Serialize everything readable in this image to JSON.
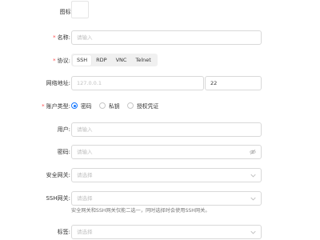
{
  "form": {
    "icon": {
      "label": "图标"
    },
    "name": {
      "label": "名称",
      "placeholder": "请输入"
    },
    "protocol": {
      "label": "协议",
      "options": [
        "SSH",
        "RDP",
        "VNC",
        "Telnet"
      ],
      "selected": "SSH"
    },
    "address": {
      "label": "网络地址",
      "host_placeholder": "127.0.0.1",
      "port_value": "22"
    },
    "account_type": {
      "label": "账户类型",
      "options": [
        "密码",
        "私钥",
        "授权凭证"
      ],
      "selected": "密码"
    },
    "user": {
      "label": "用户",
      "placeholder": "请输入"
    },
    "password": {
      "label": "密码",
      "placeholder": "请输入"
    },
    "gateway": {
      "label": "安全网关",
      "placeholder": "请选择"
    },
    "ssh_gateway": {
      "label": "SSH网关",
      "placeholder": "请选择",
      "helper": "安全网关和SSH网关仅能二选一，同时选择时会使用SSH网关。"
    },
    "tags": {
      "label": "标签",
      "placeholder": "请选择"
    }
  },
  "colors": {
    "primary": "#1677ff",
    "required": "#ff4d4f",
    "border": "#d9d9d9",
    "placeholder": "#bfbfbf"
  },
  "icons": {
    "password_toggle": "eye-off-icon",
    "select_arrow": "chevron-down-icon"
  }
}
